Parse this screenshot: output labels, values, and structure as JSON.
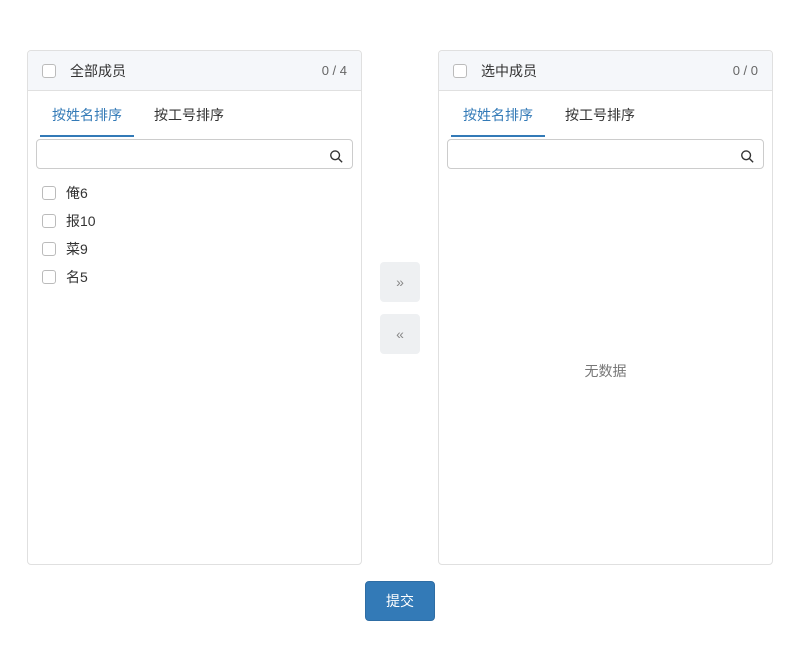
{
  "left": {
    "title": "全部成员",
    "count": "0 / 4",
    "tabs": [
      "按姓名排序",
      "按工号排序"
    ],
    "activeTab": 0,
    "items": [
      "俺6",
      "报10",
      "菜9",
      "名5"
    ]
  },
  "right": {
    "title": "选中成员",
    "count": "0 / 0",
    "tabs": [
      "按姓名排序",
      "按工号排序"
    ],
    "activeTab": 0,
    "empty": "无数据"
  },
  "controls": {
    "moveRight": "»",
    "moveLeft": "«"
  },
  "submit": "提交"
}
